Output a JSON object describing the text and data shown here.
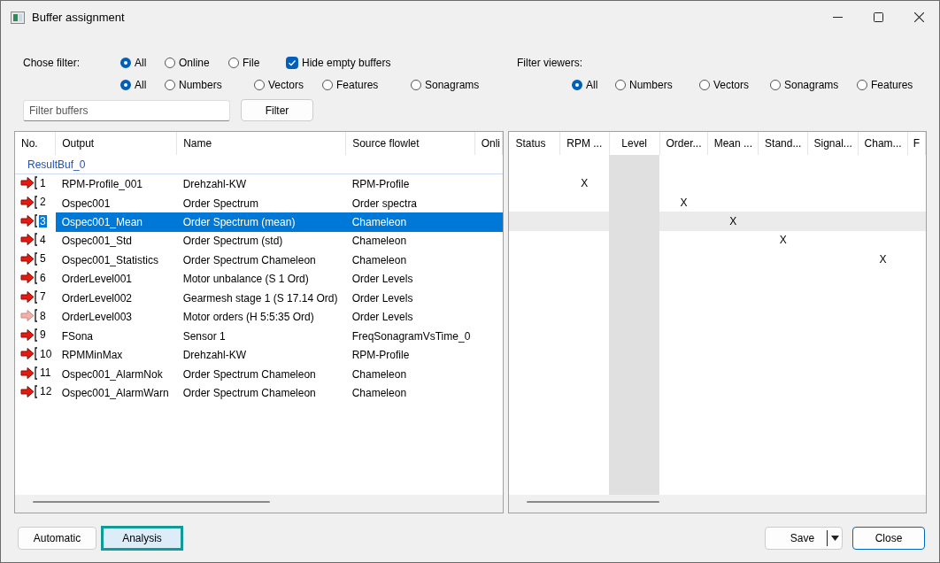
{
  "window": {
    "title": "Buffer assignment"
  },
  "filter": {
    "label": "Chose filter:",
    "source_options": [
      {
        "label": "All",
        "selected": true
      },
      {
        "label": "Online",
        "selected": false
      },
      {
        "label": "File",
        "selected": false
      }
    ],
    "hide_empty": {
      "label": "Hide empty buffers",
      "checked": true
    },
    "type_options": [
      {
        "label": "All",
        "selected": true
      },
      {
        "label": "Numbers",
        "selected": false
      },
      {
        "label": "Vectors",
        "selected": false
      },
      {
        "label": "Features",
        "selected": false
      },
      {
        "label": "Sonagrams",
        "selected": false
      }
    ],
    "search": {
      "placeholder": "Filter buffers"
    },
    "filter_button": "Filter"
  },
  "viewer_filter": {
    "label": "Filter viewers:",
    "options": [
      {
        "label": "All",
        "selected": true
      },
      {
        "label": "Numbers",
        "selected": false
      },
      {
        "label": "Vectors",
        "selected": false
      },
      {
        "label": "Sonagrams",
        "selected": false
      },
      {
        "label": "Features",
        "selected": false
      }
    ]
  },
  "buffers": {
    "columns": [
      "No.",
      "Output",
      "Name",
      "Source flowlet",
      "Onli"
    ],
    "group": "ResultBuf_0",
    "rows": [
      {
        "no": "1",
        "output": "RPM-Profile_001",
        "name": "Drehzahl-KW",
        "source": "RPM-Profile",
        "selected": false,
        "dimmed": false
      },
      {
        "no": "2",
        "output": "Ospec001",
        "name": "Order Spectrum",
        "source": "Order spectra",
        "selected": false,
        "dimmed": false
      },
      {
        "no": "3",
        "output": "Ospec001_Mean",
        "name": "Order Spectrum (mean)",
        "source": "Chameleon",
        "selected": true,
        "dimmed": false
      },
      {
        "no": "4",
        "output": "Ospec001_Std",
        "name": "Order Spectrum (std)",
        "source": "Chameleon",
        "selected": false,
        "dimmed": false
      },
      {
        "no": "5",
        "output": "Ospec001_Statistics",
        "name": "Order Spectrum Chameleon",
        "source": "Chameleon",
        "selected": false,
        "dimmed": false
      },
      {
        "no": "6",
        "output": "OrderLevel001",
        "name": "Motor unbalance (S 1 Ord)",
        "source": "Order Levels",
        "selected": false,
        "dimmed": false
      },
      {
        "no": "7",
        "output": "OrderLevel002",
        "name": "Gearmesh stage 1 (S 17.14 Ord)",
        "source": "Order Levels",
        "selected": false,
        "dimmed": false
      },
      {
        "no": "8",
        "output": "OrderLevel003",
        "name": "Motor orders (H 5:5:35 Ord)",
        "source": "Order Levels",
        "selected": false,
        "dimmed": true
      },
      {
        "no": "9",
        "output": "FSona",
        "name": "Sensor 1",
        "source": "FreqSonagramVsTime_0",
        "selected": false,
        "dimmed": false
      },
      {
        "no": "10",
        "output": "RPMMinMax",
        "name": "Drehzahl-KW",
        "source": "RPM-Profile",
        "selected": false,
        "dimmed": false
      },
      {
        "no": "11",
        "output": "Ospec001_AlarmNok",
        "name": "Order Spectrum Chameleon",
        "source": "Chameleon",
        "selected": false,
        "dimmed": false
      },
      {
        "no": "12",
        "output": "Ospec001_AlarmWarn",
        "name": "Order Spectrum Chameleon",
        "source": "Chameleon",
        "selected": false,
        "dimmed": false
      }
    ]
  },
  "viewers": {
    "columns": [
      {
        "label": "Status",
        "shaded": false
      },
      {
        "label": "RPM ...",
        "shaded": false
      },
      {
        "label": "Level",
        "shaded": true
      },
      {
        "label": "Order...",
        "shaded": false
      },
      {
        "label": "Mean ...",
        "shaded": false
      },
      {
        "label": "Stand...",
        "shaded": false
      },
      {
        "label": "Signal...",
        "shaded": false
      },
      {
        "label": "Cham...",
        "shaded": false
      },
      {
        "label": "F",
        "shaded": false
      }
    ],
    "rows": [
      {
        "selected": false,
        "cells": [
          null,
          "X",
          null,
          null,
          null,
          null,
          null,
          null,
          null
        ]
      },
      {
        "selected": false,
        "cells": [
          null,
          null,
          null,
          "X",
          null,
          null,
          null,
          null,
          null
        ]
      },
      {
        "selected": true,
        "cells": [
          null,
          null,
          null,
          null,
          "X",
          null,
          null,
          null,
          null
        ]
      },
      {
        "selected": false,
        "cells": [
          null,
          null,
          null,
          null,
          null,
          "X",
          null,
          null,
          null
        ]
      },
      {
        "selected": false,
        "cells": [
          null,
          null,
          null,
          null,
          null,
          null,
          null,
          "X",
          null
        ]
      }
    ]
  },
  "footer": {
    "buttons": [
      {
        "label": "Automatic",
        "highlighted": false
      },
      {
        "label": "Analysis",
        "highlighted": true
      }
    ],
    "save": "Save",
    "close": "Close"
  }
}
